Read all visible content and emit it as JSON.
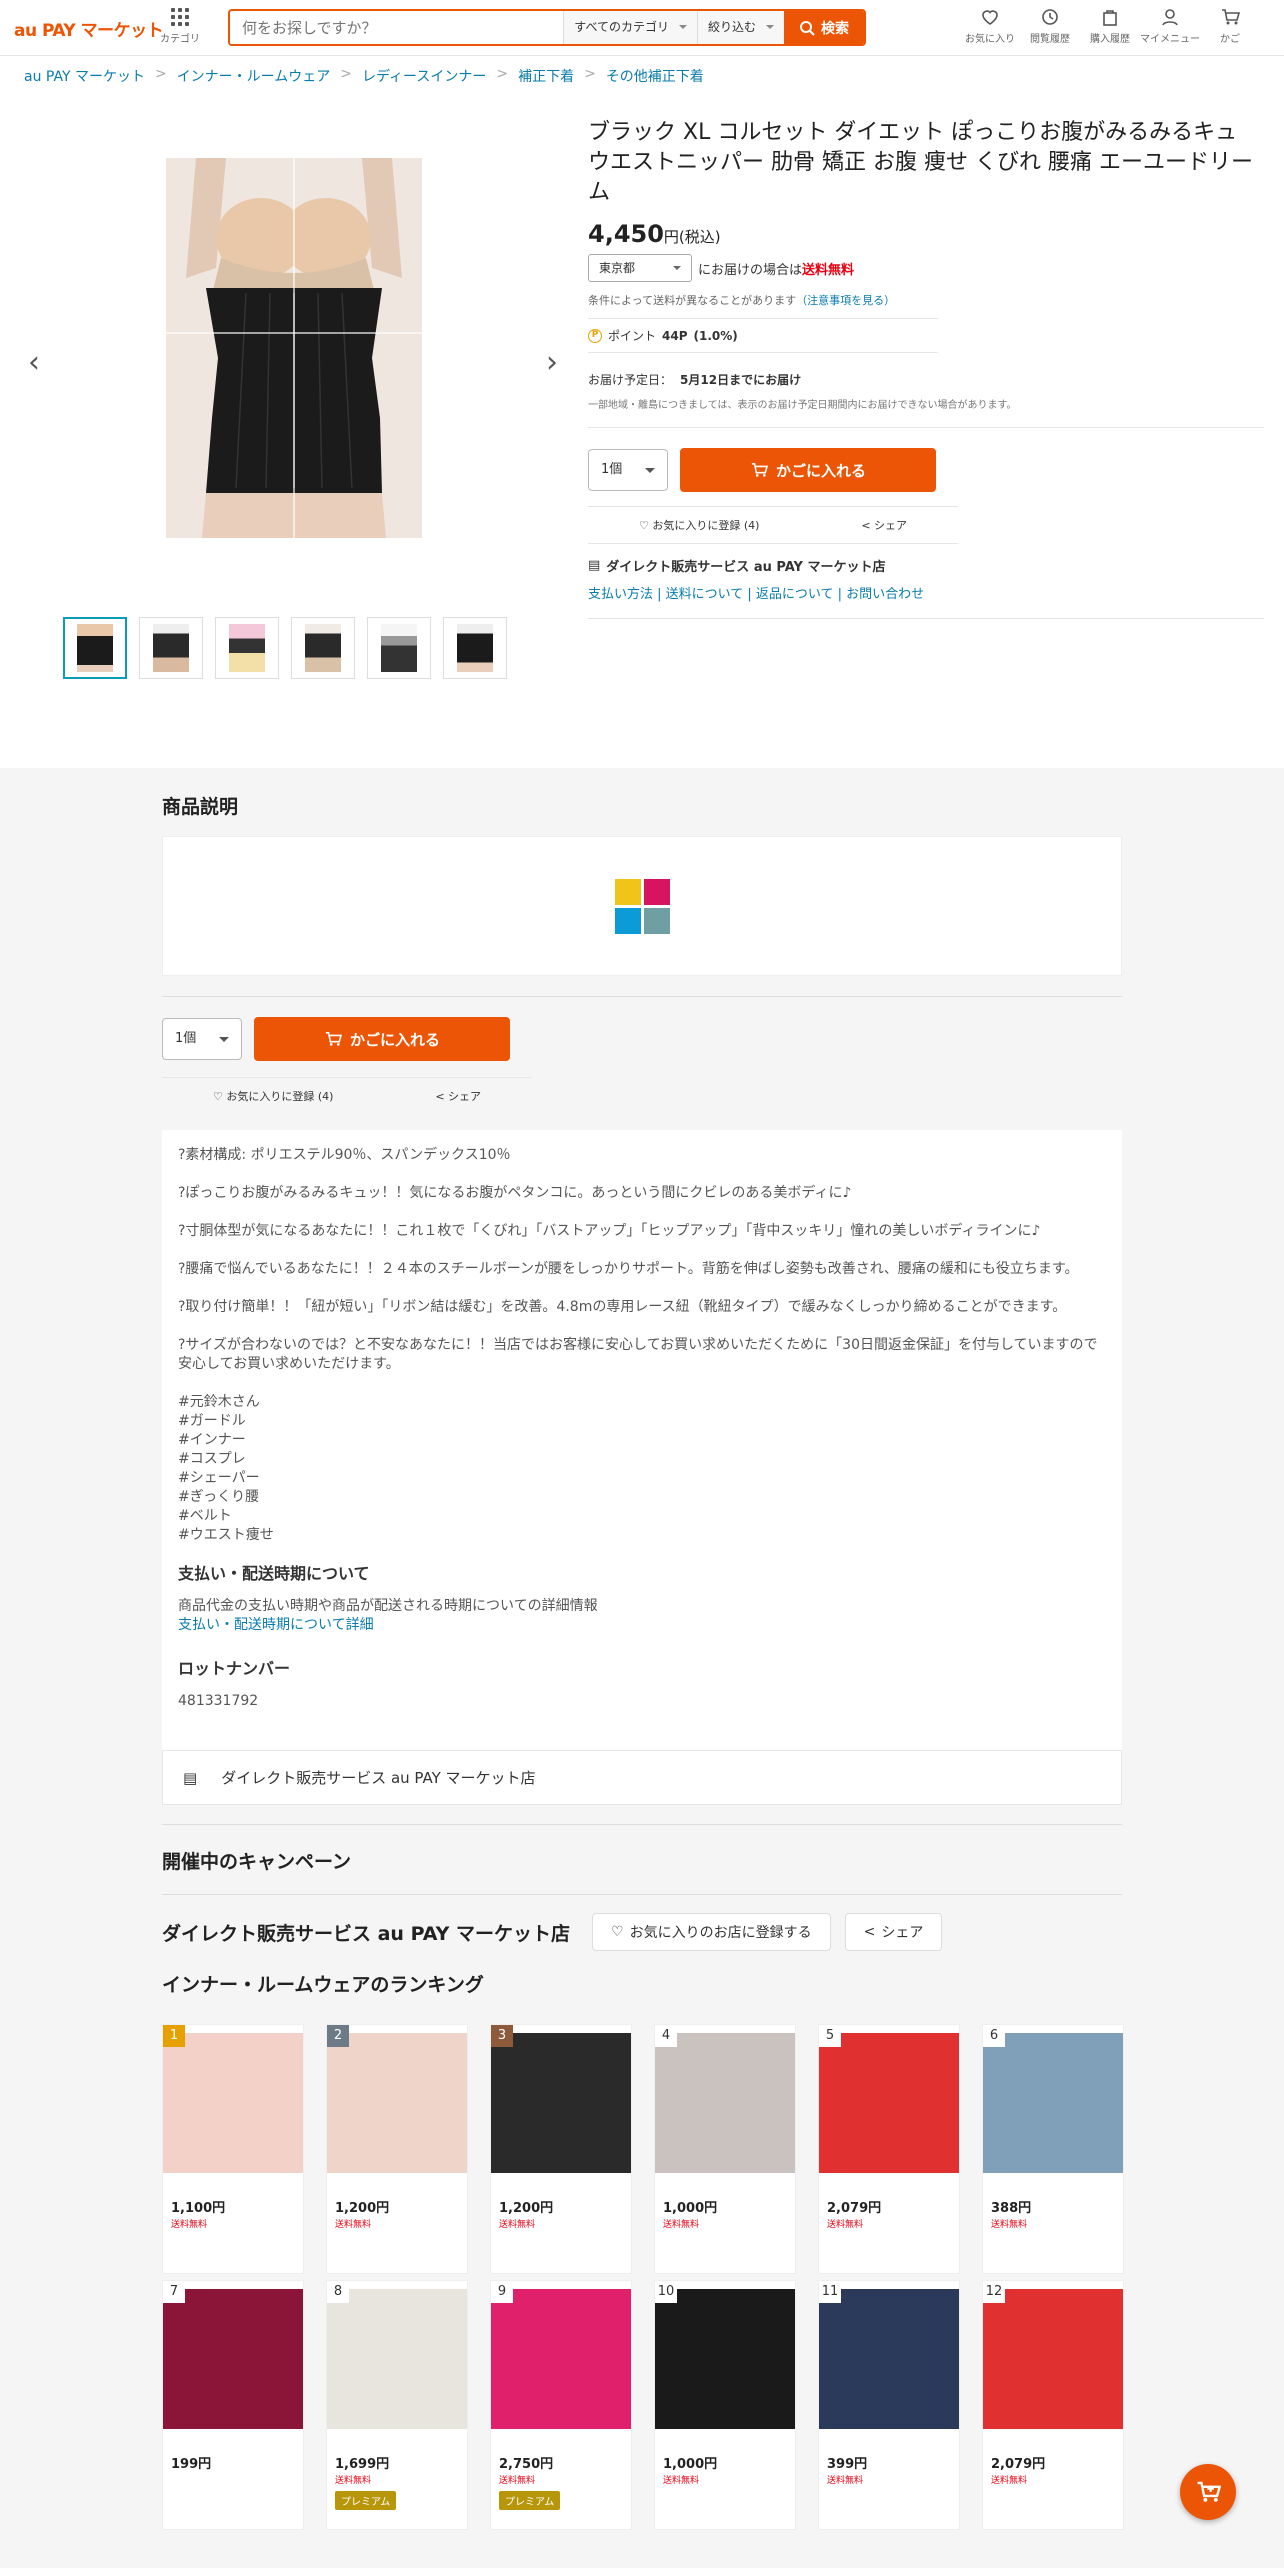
{
  "header": {
    "logo": "au PAY マーケット",
    "category": "カテゴリ",
    "search_placeholder": "何をお探しですか？",
    "category_select": "すべてのカテゴリ",
    "filter_select": "絞り込む",
    "search_btn": "検索",
    "icons": [
      {
        "name": "favorite",
        "label": "お気に入り"
      },
      {
        "name": "history",
        "label": "閲覧履歴"
      },
      {
        "name": "purchase",
        "label": "購入履歴"
      },
      {
        "name": "mymenu",
        "label": "マイメニュー"
      },
      {
        "name": "cart",
        "label": "かご"
      }
    ]
  },
  "breadcrumb": [
    "au PAY マーケット",
    "インナー・ルームウェア",
    "レディースインナー",
    "補正下着",
    "その他補正下着"
  ],
  "product": {
    "title": "ブラック XL コルセット ダイエット ぽっこりお腹がみるみるキュウエストニッパー 肋骨 矯正 お腹 痩せ くびれ 腰痛 エーユードリーム",
    "price": "4,450",
    "price_suffix": "円(税込)",
    "pref": "東京都",
    "ship_text": "にお届けの場合は",
    "ship_free": "送料無料",
    "ship_note": "条件によって送料が異なることがあります",
    "ship_note_link": "（注意事項を見る）",
    "point_label": "ポイント",
    "point_value": "44P",
    "point_rate": "(1.0%)",
    "delivery_label": "お届け予定日：",
    "delivery_date": "5月12日までにお届け",
    "delivery_note": "一部地域・離島につきましては、表示のお届け予定日期間内にお届けできない場合があります。",
    "qty": "1個",
    "cart_btn": "かごに入れる",
    "fav": "お気に入りに登録 (4)",
    "share": "シェア",
    "shop_name": "ダイレクト販売サービス au PAY マーケット店",
    "shop_links": "支払い方法 | 送料について | 返品について | お問い合わせ"
  },
  "section": {
    "desc_title": "商品説明",
    "campaign": "開催中のキャンペーン",
    "shop_title": "ダイレクト販売サービス au PAY マーケット店",
    "shop_fav": "お気に入りのお店に登録する",
    "shop_share": "シェア",
    "ranking": "インナー・ルームウェアのランキング"
  },
  "desc": {
    "lines": [
      "?素材構成: ポリエステル90％、スパンデックス10％",
      "?ぽっこりお腹がみるみるキュッ！！気になるお腹がペタンコに。あっという間にクビレのある美ボディに♪",
      "?寸胴体型が気になるあなたに！！これ１枚で「くびれ」「バストアップ」「ヒップアップ」「背中スッキリ」憧れの美しいボディラインに♪",
      "?腰痛で悩んでいるあなたに！！２４本のスチールボーンが腰をしっかりサポート。背筋を伸ばし姿勢も改善され、腰痛の緩和にも役立ちます。",
      "?取り付け簡単！！「紐が短い」「リボン結は緩む」を改善。4.8mの専用レース紐（靴紐タイプ）で緩みなくしっかり締めることができます。",
      "?サイズが合わないのでは？と不安なあなたに！！当店ではお客様に安心してお買い求めいただくために「30日間返金保証」を付与していますので安心してお買い求めいただけます。"
    ],
    "tags": [
      "#元鈴木さん",
      "#ガードル",
      "#インナー",
      "#コスプレ",
      "#シェーパー",
      "#ぎっくり腰",
      "#ベルト",
      "#ウエスト痩せ"
    ],
    "pay_title": "支払い・配送時期について",
    "pay_text": "商品代金の支払い時期や商品が配送される時期についての詳細情報",
    "pay_link": "支払い・配送時期について詳細",
    "lot_title": "ロットナンバー",
    "lot": "481331792"
  },
  "ranking": [
    {
      "rank": "1",
      "price": "1,100円",
      "free": "送料無料",
      "color": "#f3d0c8",
      "premium": ""
    },
    {
      "rank": "2",
      "price": "1,200円",
      "free": "送料無料",
      "color": "#efd4c9",
      "premium": ""
    },
    {
      "rank": "3",
      "price": "1,200円",
      "free": "送料無料",
      "color": "#2a2a2a",
      "premium": ""
    },
    {
      "rank": "4",
      "price": "1,000円",
      "free": "送料無料",
      "color": "#c9c2be",
      "premium": ""
    },
    {
      "rank": "5",
      "price": "2,079円",
      "free": "送料無料",
      "color": "#e03030",
      "premium": ""
    },
    {
      "rank": "6",
      "price": "388円",
      "free": "送料無料",
      "color": "#7fa0b8",
      "premium": ""
    },
    {
      "rank": "7",
      "price": "199円",
      "free": "",
      "color": "#8a1538",
      "premium": ""
    },
    {
      "rank": "8",
      "price": "1,699円",
      "free": "送料無料",
      "color": "#e8e4de",
      "premium": "プレミアム"
    },
    {
      "rank": "9",
      "price": "2,750円",
      "free": "送料無料",
      "color": "#e0206a",
      "premium": "プレミアム"
    },
    {
      "rank": "10",
      "price": "1,000円",
      "free": "送料無料",
      "color": "#1a1a1a",
      "premium": ""
    },
    {
      "rank": "11",
      "price": "399円",
      "free": "送料無料",
      "color": "#2b3a5a",
      "premium": ""
    },
    {
      "rank": "12",
      "price": "2,079円",
      "free": "送料無料",
      "color": "#e03030",
      "premium": ""
    }
  ]
}
